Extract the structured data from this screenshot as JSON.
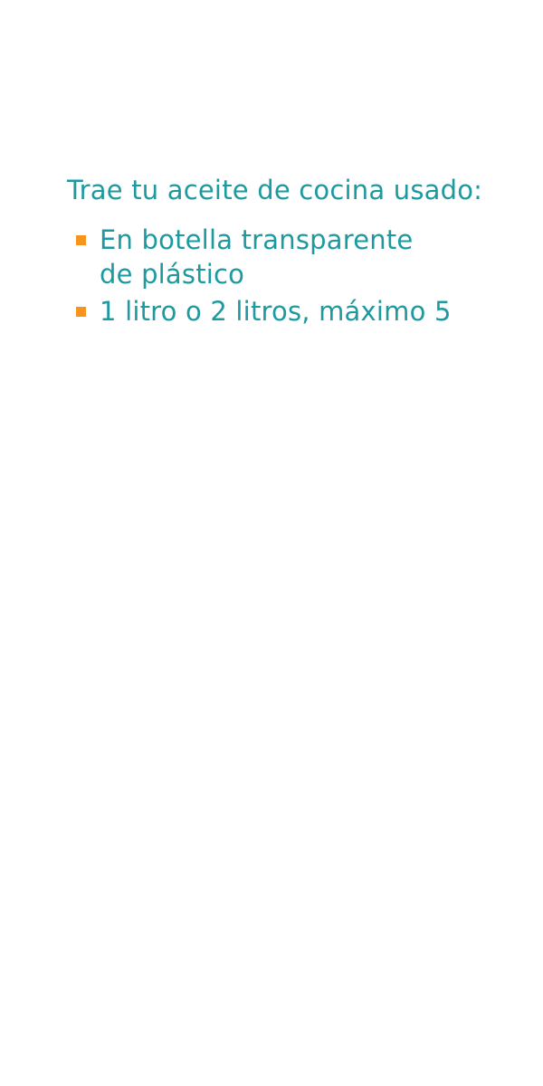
{
  "heading": "Trae tu aceite de cocina usado:",
  "items": [
    {
      "lines": [
        "En botella transparente",
        "de plástico"
      ]
    },
    {
      "lines": [
        "1 litro o 2 litros, máximo 5"
      ]
    }
  ],
  "colors": {
    "text": "#1c9aa0",
    "bullet": "#f7941d",
    "background": "#ffffff"
  }
}
